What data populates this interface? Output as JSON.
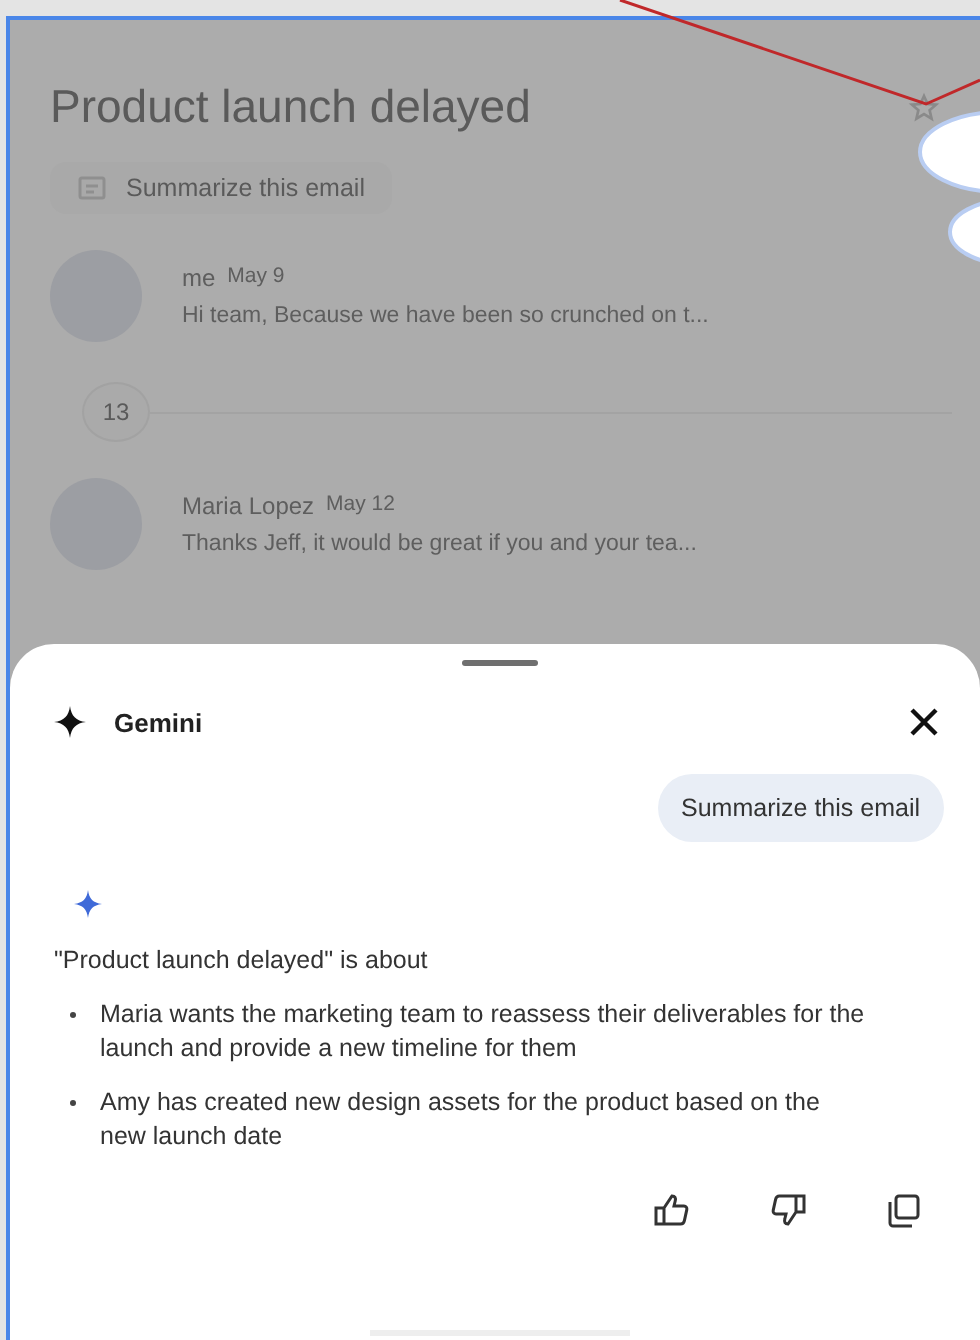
{
  "email": {
    "subject": "Product launch delayed",
    "summarize_chip": "Summarize this email",
    "messages": [
      {
        "sender": "me",
        "date": "May 9",
        "preview": "Hi team, Because we have been so crunched on t..."
      },
      {
        "collapsed_count": "13"
      },
      {
        "sender": "Maria Lopez",
        "date": "May 12",
        "preview": "Thanks Jeff, it would be great if you and your tea..."
      }
    ]
  },
  "gemini": {
    "title": "Gemini",
    "prompt": "Summarize this email",
    "intro": "\"Product launch delayed\" is about",
    "bullets": [
      "Maria wants the marketing team to reassess their deliverables for the launch and provide a new timeline for them",
      "Amy has created new design assets for the product based on the new launch date"
    ]
  }
}
